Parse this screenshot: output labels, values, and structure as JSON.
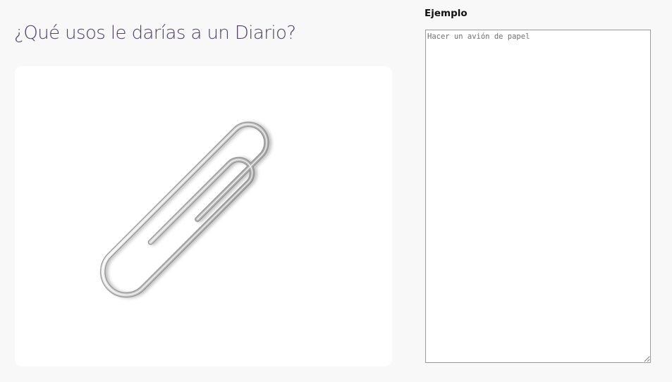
{
  "question": {
    "text": "¿Qué usos le darías a un Diario?"
  },
  "image": {
    "subject": "paperclip",
    "icon": "paperclip-icon"
  },
  "answer_field": {
    "label": "Ejemplo",
    "placeholder": "Hacer un avión de papel",
    "value": ""
  }
}
